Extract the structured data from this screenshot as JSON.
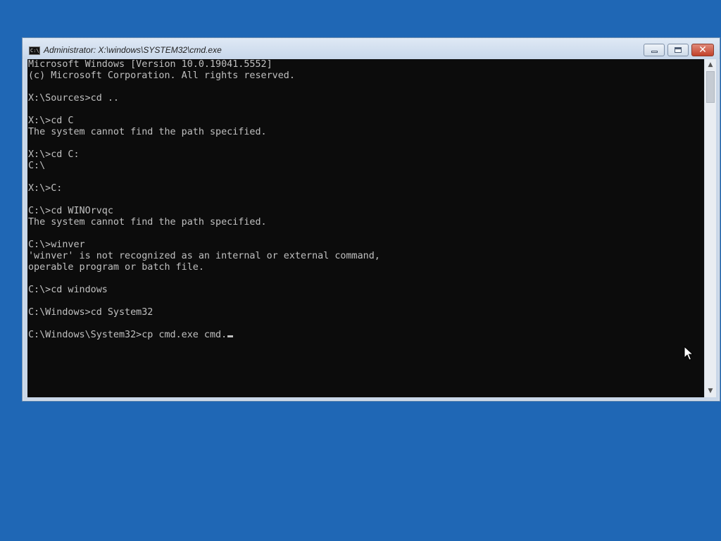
{
  "window": {
    "title": "Administrator: X:\\windows\\SYSTEM32\\cmd.exe",
    "icon_label": "C:\\",
    "buttons": {
      "minimize": "minimize-icon",
      "maximize": "maximize-icon",
      "close": "close-icon",
      "close_glyph": "✕"
    }
  },
  "console": {
    "background": "#0c0c0c",
    "text_color": "#c0c0c0",
    "lines": [
      "Microsoft Windows [Version 10.0.19041.5552]",
      "(c) Microsoft Corporation. All rights reserved.",
      "",
      "X:\\Sources>cd ..",
      "",
      "X:\\>cd C",
      "The system cannot find the path specified.",
      "",
      "X:\\>cd C:",
      "C:\\",
      "",
      "X:\\>C:",
      "",
      "C:\\>cd WINOrvqc",
      "The system cannot find the path specified.",
      "",
      "C:\\>winver",
      "'winver' is not recognized as an internal or external command,",
      "operable program or batch file.",
      "",
      "C:\\>cd windows",
      "",
      "C:\\Windows>cd System32",
      "",
      "C:\\Windows\\System32>cp cmd.exe cmd."
    ]
  },
  "scrollbar": {
    "up_arrow": "▲",
    "down_arrow": "▼"
  },
  "colors": {
    "desktop": "#1f67b5",
    "close_button": "#c2412a"
  }
}
